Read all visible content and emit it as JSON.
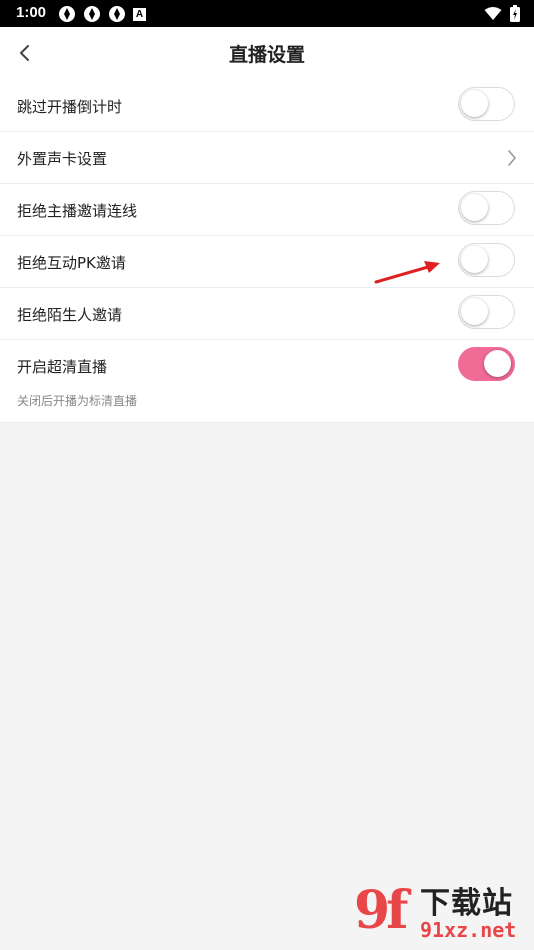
{
  "status_bar": {
    "time": "1:00",
    "left_icons": [
      "aperture-icon",
      "aperture-icon",
      "aperture-icon",
      "a-badge-icon"
    ],
    "right_icons": [
      "wifi-icon",
      "battery-icon"
    ],
    "badge_letter": "A"
  },
  "header": {
    "title": "直播设置",
    "back_icon": "chevron-left-icon"
  },
  "settings": [
    {
      "label": "跳过开播倒计时",
      "control": "toggle",
      "on": false
    },
    {
      "label": "外置声卡设置",
      "control": "chevron"
    },
    {
      "label": "拒绝主播邀请连线",
      "control": "toggle",
      "on": false
    },
    {
      "label": "拒绝互动PK邀请",
      "control": "toggle",
      "on": false
    },
    {
      "label": "拒绝陌生人邀请",
      "control": "toggle",
      "on": false
    },
    {
      "label": "开启超清直播",
      "control": "toggle",
      "on": true,
      "note": "关闭后开播为标清直播"
    }
  ],
  "colors": {
    "toggle_on": "#f06b96",
    "annotation_arrow": "#e02020",
    "watermark_red": "#e8474a"
  },
  "watermark": {
    "logo": "9f",
    "cn": "下载站",
    "en": "91xz.net"
  }
}
